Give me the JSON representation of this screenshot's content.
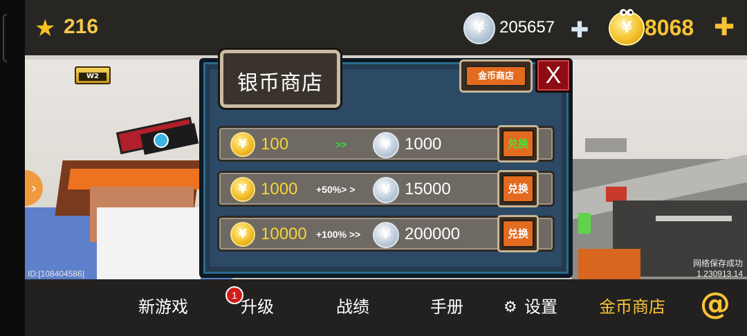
{
  "top": {
    "stars": "216",
    "silver": "205657",
    "gold": "8068",
    "silver_coin_glyph": "¥",
    "gold_coin_glyph": "¥",
    "plus": "✚"
  },
  "shop": {
    "title": "银币商店",
    "tab_gold_label": "金币商店",
    "close_label": "X",
    "rows": [
      {
        "gold": "100",
        "bonus": ">>",
        "silver": "1000",
        "button": "兑换"
      },
      {
        "gold": "1000",
        "bonus": "+50%> >",
        "silver": "15000",
        "button": "兑换"
      },
      {
        "gold": "10000",
        "bonus": "+100% >>",
        "silver": "200000",
        "button": "兑换"
      }
    ]
  },
  "scene": {
    "player_id": "ID:[108404586]",
    "save_status": "网络保存成功",
    "version": "1.230913.14",
    "weapon_badge": "W2"
  },
  "nav": {
    "new_game": "新游戏",
    "upgrade": "升级",
    "upgrade_badge": "1",
    "record": "战绩",
    "manual": "手册",
    "settings": "设置",
    "gold_shop": "金币商店",
    "at": "@"
  },
  "icons": [
    "star-icon",
    "silver-coin-icon",
    "gold-coin-icon",
    "plus-icon",
    "gear-icon",
    "at-icon",
    "chevron-right-icon"
  ],
  "colors": {
    "gold": "#f7c332",
    "exchange_button": "#e26b1f",
    "close_button": "#8d0d14",
    "panel": "#2c4a66"
  }
}
